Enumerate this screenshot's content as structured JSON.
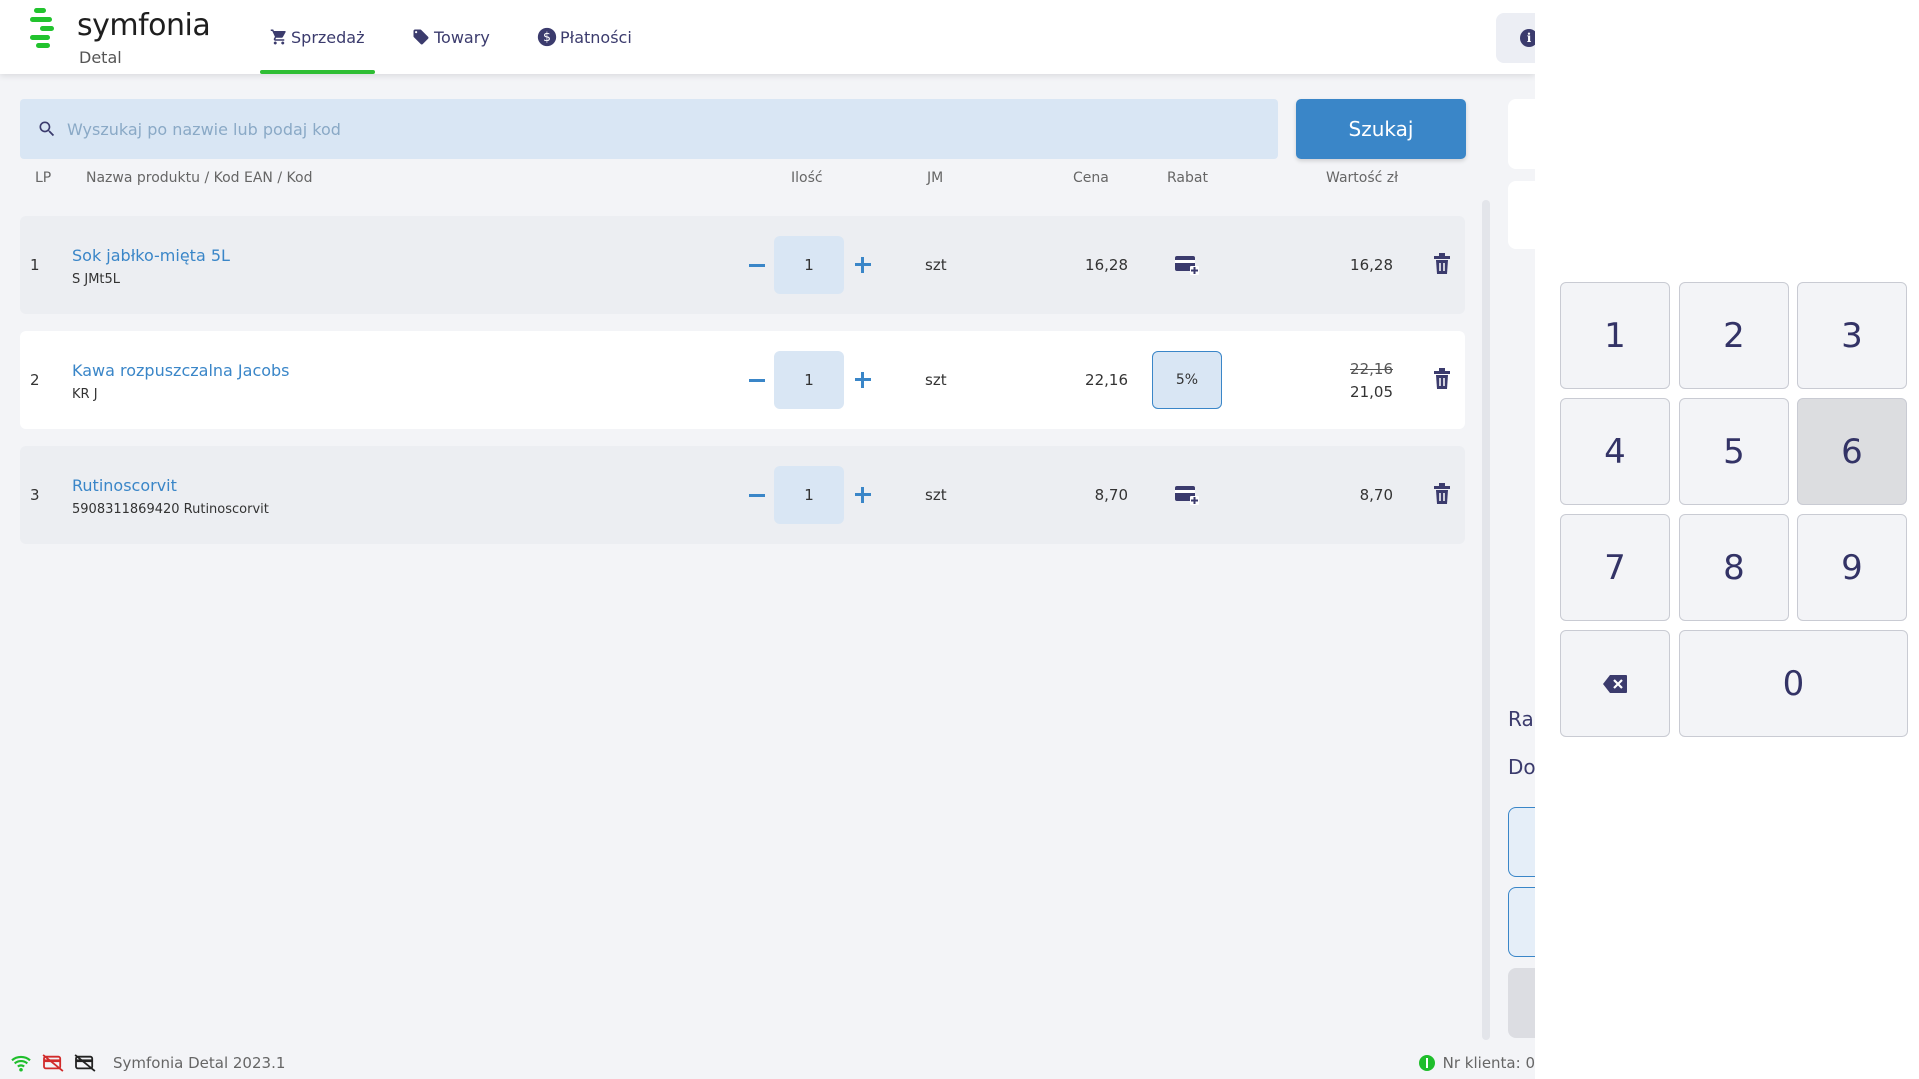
{
  "app": {
    "brand": "symfonia",
    "subtitle": "Detal",
    "nav": [
      {
        "label": "Sprzedaż",
        "icon": "cart-icon",
        "active": true
      },
      {
        "label": "Towary",
        "icon": "tag-icon",
        "active": false
      },
      {
        "label": "Płatności",
        "icon": "dollar-circle-icon",
        "active": false
      }
    ]
  },
  "search": {
    "placeholder": "Wyszukaj po nazwie lub podaj kod",
    "button_label": "Szukaj"
  },
  "table": {
    "headers": {
      "lp": "LP",
      "name": "Nazwa produktu / Kod EAN / Kod",
      "qty": "Ilość",
      "unit": "JM",
      "price": "Cena",
      "discount": "Rabat",
      "value": "Wartość zł"
    },
    "rows": [
      {
        "lp": "1",
        "name": "Sok jabłko-mięta 5L",
        "code": "S JMt5L",
        "qty": "1",
        "unit": "szt",
        "price": "16,28",
        "discount": "",
        "value": "16,28"
      },
      {
        "lp": "2",
        "name": "Kawa rozpuszczalna Jacobs",
        "code": "KR J",
        "qty": "1",
        "unit": "szt",
        "price": "22,16",
        "discount": "5%",
        "value_old": "22,16",
        "value": "21,05"
      },
      {
        "lp": "3",
        "name": "Rutinoscorvit",
        "code": "5908311869420 Rutinoscorvit",
        "qty": "1",
        "unit": "szt",
        "price": "8,70",
        "discount": "",
        "value": "8,70"
      }
    ]
  },
  "side": {
    "label1": "Ra",
    "label2": "Do"
  },
  "footer": {
    "version": "Symfonia Detal 2023.1",
    "client": "Nr klienta: 0"
  },
  "numpad": {
    "keys": [
      "1",
      "2",
      "3",
      "4",
      "5",
      "6",
      "7",
      "8",
      "9",
      "0"
    ],
    "pressed_key": "6"
  },
  "colors": {
    "accent": "#3a86c8",
    "brand_green": "#22c32e",
    "navy": "#3b3b6d"
  }
}
